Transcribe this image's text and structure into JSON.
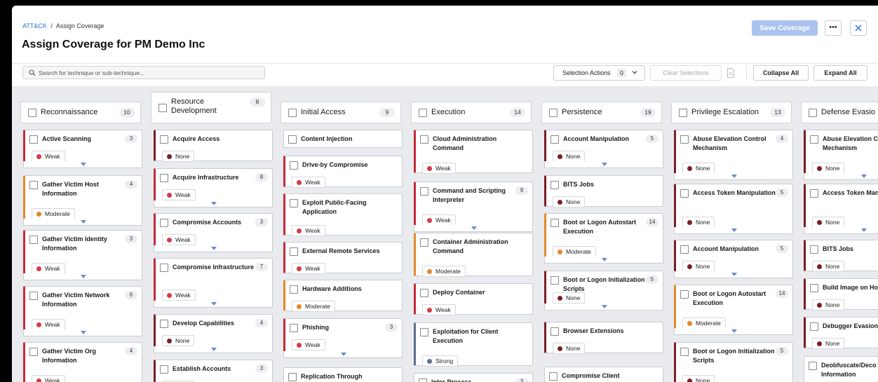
{
  "breadcrumb": {
    "root": "ATT&CK",
    "separator": "/",
    "current": "Assign Coverage"
  },
  "page_title": "Assign Coverage for PM Demo Inc",
  "header": {
    "save_label": "Save Coverage",
    "more_label": "•••"
  },
  "toolbar": {
    "search_placeholder": "Search for technique or sub-technique...",
    "selection_actions_label": "Selection Actions",
    "selection_count": "0",
    "clear_label": "Clear Selections",
    "collapse_label": "Collapse All",
    "expand_label": "Expand All"
  },
  "colors": {
    "weak": "#d63a47",
    "none": "#7a1f25",
    "moderate": "#e7862a",
    "strong": "#5c6f8e",
    "accent": "#2b6cd4"
  },
  "tactics": [
    {
      "name": "Reconnaissance",
      "count": "10"
    },
    {
      "name": "Resource Development",
      "count": "8"
    },
    {
      "name": "Initial Access",
      "count": "9"
    },
    {
      "name": "Execution",
      "count": "14"
    },
    {
      "name": "Persistence",
      "count": "19"
    },
    {
      "name": "Privilege Escalation",
      "count": "13"
    },
    {
      "name": "Defense Evasio",
      "count": ""
    }
  ],
  "techniques": [
    [
      {
        "name": "Active Scanning",
        "count": "3",
        "coverage": "Weak"
      },
      {
        "name": "Gather Victim Host Information",
        "count": "4",
        "coverage": "Moderate"
      },
      {
        "name": "Gather Victim Identity Information",
        "count": "3",
        "coverage": "Weak"
      },
      {
        "name": "Gather Victim Network Information",
        "count": "6",
        "coverage": "Weak"
      },
      {
        "name": "Gather Victim Org Information",
        "count": "4",
        "coverage": "Weak"
      }
    ],
    [
      {
        "name": "Acquire Access",
        "count": "",
        "coverage": "None"
      },
      {
        "name": "Acquire Infrastructure",
        "count": "8",
        "coverage": "Weak"
      },
      {
        "name": "Compromise Accounts",
        "count": "3",
        "coverage": "Weak"
      },
      {
        "name": "Compromise Infrastructure",
        "count": "7",
        "coverage": "Weak"
      },
      {
        "name": "Develop Capabilities",
        "count": "4",
        "coverage": "None"
      },
      {
        "name": "Establish Accounts",
        "count": "3",
        "coverage": "None"
      }
    ],
    [
      {
        "name": "Content Injection",
        "count": "",
        "coverage": ""
      },
      {
        "name": "Drive-by Compromise",
        "count": "",
        "coverage": "Weak"
      },
      {
        "name": "Exploit Public-Facing Application",
        "count": "",
        "coverage": "Weak"
      },
      {
        "name": "External Remote Services",
        "count": "",
        "coverage": "Weak"
      },
      {
        "name": "Hardware Additions",
        "count": "",
        "coverage": "Moderate"
      },
      {
        "name": "Phishing",
        "count": "3",
        "coverage": "Weak"
      },
      {
        "name": "Replication Through Removable Media",
        "count": "",
        "coverage": ""
      }
    ],
    [
      {
        "name": "Cloud Administration Command",
        "count": "",
        "coverage": "Weak"
      },
      {
        "name": "Command and Scripting Interpreter",
        "count": "9",
        "coverage": "Weak"
      },
      {
        "name": "Container Administration Command",
        "count": "",
        "coverage": "Moderate"
      },
      {
        "name": "Deploy Container",
        "count": "",
        "coverage": "Weak"
      },
      {
        "name": "Exploitation for Client Execution",
        "count": "",
        "coverage": "Strong"
      },
      {
        "name": "Inter-Process",
        "count": "3",
        "coverage": ""
      }
    ],
    [
      {
        "name": "Account Manipulation",
        "count": "5",
        "coverage": "None"
      },
      {
        "name": "BITS Jobs",
        "count": "",
        "coverage": "None"
      },
      {
        "name": "Boot or Logon Autostart Execution",
        "count": "14",
        "coverage": "Moderate"
      },
      {
        "name": "Boot or Logon Initialization Scripts",
        "count": "5",
        "coverage": "None"
      },
      {
        "name": "Browser Extensions",
        "count": "",
        "coverage": "None"
      },
      {
        "name": "Compromise Client Software Binary",
        "count": "",
        "coverage": ""
      }
    ],
    [
      {
        "name": "Abuse Elevation Control Mechanism",
        "count": "4",
        "coverage": "None"
      },
      {
        "name": "Access Token Manipulation",
        "count": "5",
        "coverage": "None"
      },
      {
        "name": "Account Manipulation",
        "count": "5",
        "coverage": "None"
      },
      {
        "name": "Boot or Logon Autostart Execution",
        "count": "14",
        "coverage": "Moderate"
      },
      {
        "name": "Boot or Logon Initialization Scripts",
        "count": "5",
        "coverage": "None"
      }
    ],
    [
      {
        "name": "Abuse Elevation C Mechanism",
        "count": "",
        "coverage": "None"
      },
      {
        "name": "Access Token Manipulation",
        "count": "",
        "coverage": "None"
      },
      {
        "name": "BITS Jobs",
        "count": "",
        "coverage": "None"
      },
      {
        "name": "Build Image on Ho",
        "count": "",
        "coverage": "None"
      },
      {
        "name": "Debugger Evasion",
        "count": "",
        "coverage": "None"
      },
      {
        "name": "Deobfuscate/Deco or Information",
        "count": "",
        "coverage": ""
      }
    ]
  ]
}
